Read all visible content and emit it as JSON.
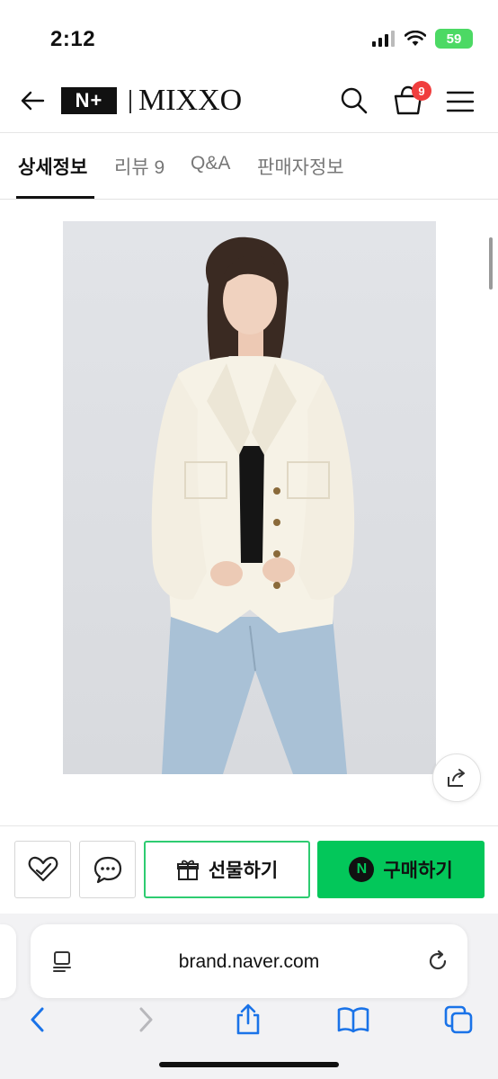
{
  "status_bar": {
    "time": "2:12",
    "battery": "59"
  },
  "header": {
    "logo_badge": "N+",
    "brand": "MIXXO",
    "cart_count": "9"
  },
  "tabs": [
    {
      "label": "상세정보",
      "active": true
    },
    {
      "label": "리뷰 9",
      "active": false
    },
    {
      "label": "Q&A",
      "active": false
    },
    {
      "label": "판매자정보",
      "active": false
    }
  ],
  "actions": {
    "gift_label": "선물하기",
    "buy_label": "구매하기",
    "buy_icon_letter": "N"
  },
  "browser": {
    "url": "brand.naver.com"
  },
  "colors": {
    "buy_green": "#03c75a",
    "badge_red": "#f03e3e",
    "link_blue": "#1a73e8"
  },
  "icons": {
    "back": "arrow-left-icon",
    "search": "search-icon",
    "cart": "shopping-bag-icon",
    "menu": "hamburger-menu-icon",
    "share": "share-icon",
    "wish": "heart-check-icon",
    "chat": "chat-bubble-icon",
    "gift": "gift-icon"
  }
}
